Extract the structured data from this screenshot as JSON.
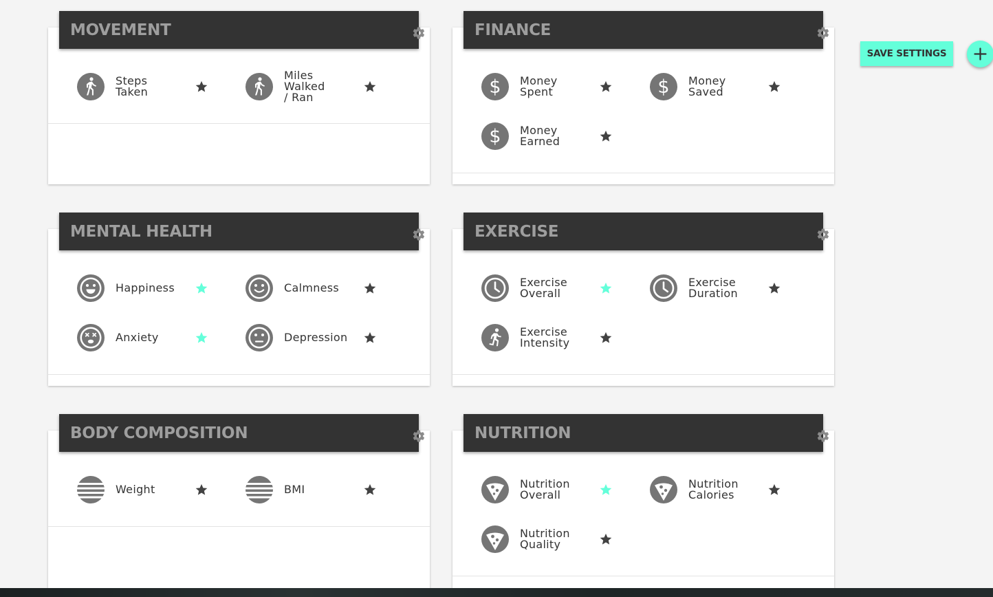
{
  "colors": {
    "accent": "#64ffda",
    "header_bg": "#333333",
    "header_text": "#9e9e9e",
    "icon_gray": "#757575",
    "star_dark": "#424242"
  },
  "toolbar": {
    "save_label": "SAVE SETTINGS",
    "add_icon": "plus-icon"
  },
  "cards": {
    "movement": {
      "title": "MOVEMENT",
      "items": [
        {
          "label": "Steps Taken",
          "icon": "walking-icon",
          "favorite": false
        },
        {
          "label_line1": "Miles Walked",
          "label_line2": "/ Ran",
          "icon": "walking-icon",
          "favorite": false
        }
      ]
    },
    "finance": {
      "title": "FINANCE",
      "items": [
        {
          "label": "Money Spent",
          "icon": "dollar-icon",
          "favorite": false
        },
        {
          "label": "Money Saved",
          "icon": "dollar-icon",
          "favorite": false
        },
        {
          "label": "Money Earned",
          "icon": "dollar-icon",
          "favorite": false
        }
      ]
    },
    "mental_health": {
      "title": "MENTAL HEALTH",
      "items": [
        {
          "label": "Happiness",
          "icon": "very-happy-face-icon",
          "favorite": true
        },
        {
          "label": "Calmness",
          "icon": "happy-face-icon",
          "favorite": false
        },
        {
          "label": "Anxiety",
          "icon": "dizzy-face-icon",
          "favorite": true
        },
        {
          "label": "Depression",
          "icon": "neutral-face-icon",
          "favorite": false
        }
      ]
    },
    "exercise": {
      "title": "EXERCISE",
      "items": [
        {
          "label_line1": "Exercise",
          "label_line2": "Overall",
          "icon": "clock-icon",
          "favorite": true
        },
        {
          "label_line1": "Exercise",
          "label_line2": "Duration",
          "icon": "clock-icon",
          "favorite": false
        },
        {
          "label_line1": "Exercise",
          "label_line2": "Intensity",
          "icon": "running-icon",
          "favorite": false
        }
      ]
    },
    "body_composition": {
      "title": "BODY COMPOSITION",
      "items": [
        {
          "label": "Weight",
          "icon": "scale-icon",
          "favorite": false
        },
        {
          "label": "BMI",
          "icon": "scale-icon",
          "favorite": false
        }
      ]
    },
    "nutrition": {
      "title": "NUTRITION",
      "items": [
        {
          "label_line1": "Nutrition",
          "label_line2": "Overall",
          "icon": "pizza-icon",
          "favorite": true
        },
        {
          "label_line1": "Nutrition",
          "label_line2": "Calories",
          "icon": "pizza-icon",
          "favorite": false
        },
        {
          "label_line1": "Nutrition",
          "label_line2": "Quality",
          "icon": "pizza-icon",
          "favorite": false
        }
      ]
    }
  }
}
